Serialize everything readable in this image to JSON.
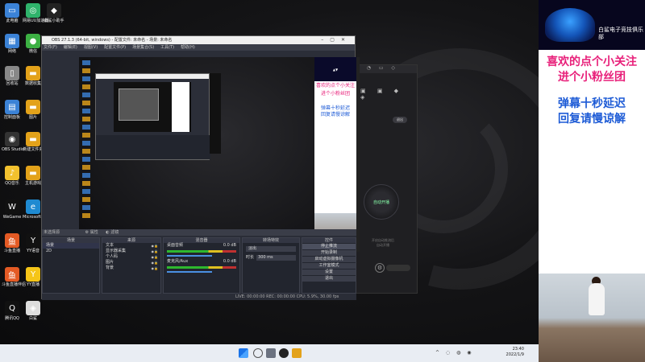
{
  "desktop": {
    "icons": [
      {
        "label": "此电脑",
        "color": "#3b82d6",
        "glyph": "▭"
      },
      {
        "label": "网易UU加速器",
        "color": "#2fb36b",
        "glyph": "◎"
      },
      {
        "label": "白鲨小助手",
        "color": "#222",
        "glyph": "◆"
      },
      {
        "label": "网络",
        "color": "#3b82d6",
        "glyph": "▦"
      },
      {
        "label": "微信",
        "color": "#3cb043",
        "glyph": "●"
      },
      {
        "label": "回收站",
        "color": "#888",
        "glyph": "▯"
      },
      {
        "label": "数据收集",
        "color": "#e3a21a",
        "glyph": "▬"
      },
      {
        "label": "控制面板",
        "color": "#3b82d6",
        "glyph": "▤"
      },
      {
        "label": "图片",
        "color": "#e3a21a",
        "glyph": "▬"
      },
      {
        "label": "OBS Studio",
        "color": "#333",
        "glyph": "◉"
      },
      {
        "label": "新建文件夹",
        "color": "#e3a21a",
        "glyph": "▬"
      },
      {
        "label": "QQ音乐",
        "color": "#f2c12e",
        "glyph": "♪"
      },
      {
        "label": "主机游戏",
        "color": "#e3a21a",
        "glyph": "▬"
      },
      {
        "label": "WeGame",
        "color": "#111",
        "glyph": "W"
      },
      {
        "label": "Microsoft Edge",
        "color": "#1f8ad1",
        "glyph": "e"
      },
      {
        "label": "斗鱼直播",
        "color": "#e45a24",
        "glyph": "鱼"
      },
      {
        "label": "YY语音",
        "color": "#111",
        "glyph": "Y"
      },
      {
        "label": "斗鱼直播伴侣",
        "color": "#e45a24",
        "glyph": "鱼"
      },
      {
        "label": "YY直播",
        "color": "#f5c518",
        "glyph": "Y"
      },
      {
        "label": "腾讯QQ",
        "color": "#111",
        "glyph": "Q"
      },
      {
        "label": "白鲨",
        "color": "#ddd",
        "glyph": "◈"
      }
    ]
  },
  "obs": {
    "title": "OBS 27.1.3 (64-bit, windows) - 配置文件: 未命名 - 场景: 未命名",
    "menu": [
      "文件(F)",
      "编辑(E)",
      "视图(V)",
      "配置文件(P)",
      "场景集合(S)",
      "工具(T)",
      "帮助(H)"
    ],
    "scene_toolbar": "未选择源",
    "prop_label": "属性",
    "filter_label": "滤镜",
    "panels": {
      "scenes_header": "场景",
      "scenes": [
        "场景",
        "2D"
      ],
      "sources_header": "来源",
      "sources": [
        "文本",
        "显示器采集",
        "个人码",
        "图片",
        "背景"
      ],
      "mixer_header": "混音器",
      "mixer": [
        {
          "name": "桌面音频",
          "value": "0.0 dB"
        },
        {
          "name": "麦克风/Aux",
          "value": "0.0 dB"
        }
      ],
      "transitions_header": "转场特效",
      "transition_type": "淡出",
      "transition_duration_label": "时长",
      "transition_duration": "300 ms",
      "controls_header": "控件",
      "controls": [
        "停止推流",
        "开始录制",
        "启动虚拟摄像机",
        "工作室模式",
        "设置",
        "退出"
      ]
    },
    "status": "LIVE: 00:00:00   REC: 00:00:00   CPU: 5.9%, 30.00 fps"
  },
  "overlay": {
    "club_name": "白鲨电子竞技俱乐部",
    "line1": "喜欢的点个小关注",
    "line2": "进个小粉丝团",
    "line3": "弹幕十秒延迟",
    "line4": "回复请慢谅解"
  },
  "bgapp": {
    "button_top": "退出",
    "circle_label": "自动开播",
    "note_line1": "开启自动推流后",
    "note_line2": "自动开播"
  },
  "taskbar": {
    "time": "23:40",
    "date": "2022/1/9"
  },
  "colors": {
    "pink": "#e8207a",
    "blue": "#1d5bd6",
    "obs_bg": "#2b2e38"
  }
}
